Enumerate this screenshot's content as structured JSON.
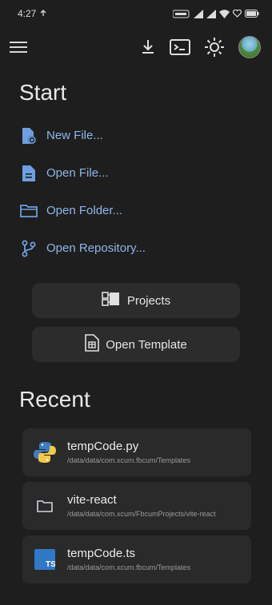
{
  "status_bar": {
    "time": "4:27"
  },
  "toolbar": {
    "menu_icon": "hamburger-icon",
    "download_icon": "download-icon",
    "terminal_icon": "terminal-icon",
    "theme_icon": "sun-icon"
  },
  "start": {
    "title": "Start",
    "items": [
      {
        "label": "New File...",
        "icon": "new-file-icon"
      },
      {
        "label": "Open File...",
        "icon": "open-file-icon"
      },
      {
        "label": "Open Folder...",
        "icon": "folder-icon"
      },
      {
        "label": "Open Repository...",
        "icon": "branch-icon"
      }
    ],
    "accent": "#8fb6ea"
  },
  "buttons": {
    "projects": "Projects",
    "open_template": "Open Template"
  },
  "recent": {
    "title": "Recent",
    "items": [
      {
        "name": "tempCode.py",
        "path": "/data/data/com.xcum.fbcum/Templates",
        "icon": "python-icon"
      },
      {
        "name": "vite-react",
        "path": "/data/data/com.xcum/FbcumProjects/vite-react",
        "icon": "folder-icon"
      },
      {
        "name": "tempCode.ts",
        "path": "/data/data/com.xcum.fbcum/Templates",
        "icon": "typescript-icon"
      }
    ]
  }
}
